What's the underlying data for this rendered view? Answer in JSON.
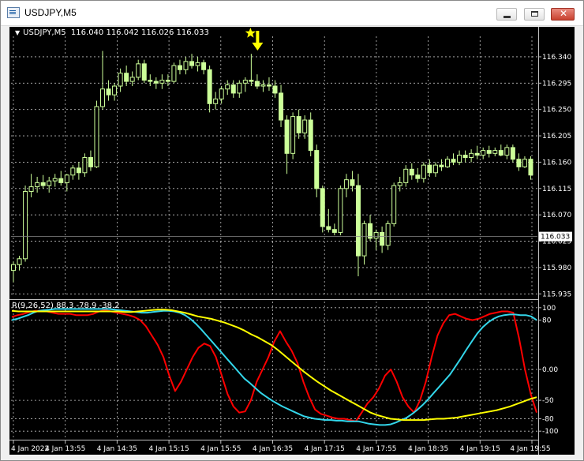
{
  "window": {
    "title": "USDJPY,M5",
    "minimize_icon": "minimize-icon",
    "maximize_icon": "maximize-icon",
    "close_icon": "close-icon"
  },
  "chart_header": {
    "symbol": "USDJPY,M5",
    "ohlc": "116.040 116.042 116.026 116.033"
  },
  "indicator_header": {
    "text": "R(9,26,52) 88.3 -78.9 -38.2"
  },
  "colors": {
    "background": "#000000",
    "candle": "#ccff99",
    "grid": "#c0c0c0",
    "axis_text": "#ffffff",
    "line_red": "#ff0000",
    "line_cyan": "#33d6ea",
    "line_yellow": "#ffff00",
    "marker": "#ffff00",
    "current_price_bg": "#ffffff"
  },
  "chart_data": [
    {
      "type": "candlestick",
      "title": "USDJPY,M5",
      "y_ticks": [
        "116.340",
        "116.295",
        "116.250",
        "116.205",
        "116.160",
        "116.115",
        "116.070",
        "116.025",
        "115.980",
        "115.935"
      ],
      "current_price": "116.033",
      "x_ticks": [
        "4 Jan 2022",
        "4 Jan 13:55",
        "4 Jan 14:35",
        "4 Jan 15:15",
        "4 Jan 15:55",
        "4 Jan 16:35",
        "4 Jan 17:15",
        "4 Jan 17:55",
        "4 Jan 18:35",
        "4 Jan 19:15",
        "4 Jan 19:55"
      ],
      "ylim": [
        115.93,
        116.375
      ],
      "grid": true,
      "annotations": [
        "star-marker",
        "down-arrow-marker"
      ],
      "candles": [
        {
          "o": 115.975,
          "h": 115.99,
          "l": 115.955,
          "c": 115.985
        },
        {
          "o": 115.985,
          "h": 116.0,
          "l": 115.975,
          "c": 115.995
        },
        {
          "o": 115.995,
          "h": 116.12,
          "l": 115.99,
          "c": 116.11
        },
        {
          "o": 116.11,
          "h": 116.14,
          "l": 116.1,
          "c": 116.118
        },
        {
          "o": 116.118,
          "h": 116.135,
          "l": 116.108,
          "c": 116.125
        },
        {
          "o": 116.125,
          "h": 116.138,
          "l": 116.115,
          "c": 116.12
        },
        {
          "o": 116.12,
          "h": 116.135,
          "l": 116.108,
          "c": 116.128
        },
        {
          "o": 116.128,
          "h": 116.14,
          "l": 116.118,
          "c": 116.132
        },
        {
          "o": 116.132,
          "h": 116.145,
          "l": 116.12,
          "c": 116.125
        },
        {
          "o": 116.125,
          "h": 116.14,
          "l": 116.11,
          "c": 116.138
        },
        {
          "o": 116.138,
          "h": 116.155,
          "l": 116.13,
          "c": 116.15
        },
        {
          "o": 116.15,
          "h": 116.16,
          "l": 116.13,
          "c": 116.142
        },
        {
          "o": 116.142,
          "h": 116.175,
          "l": 116.135,
          "c": 116.168
        },
        {
          "o": 116.168,
          "h": 116.18,
          "l": 116.145,
          "c": 116.152
        },
        {
          "o": 116.152,
          "h": 116.265,
          "l": 116.15,
          "c": 116.255
        },
        {
          "o": 116.255,
          "h": 116.35,
          "l": 116.25,
          "c": 116.285
        },
        {
          "o": 116.285,
          "h": 116.3,
          "l": 116.265,
          "c": 116.275
        },
        {
          "o": 116.275,
          "h": 116.295,
          "l": 116.265,
          "c": 116.29
        },
        {
          "o": 116.29,
          "h": 116.32,
          "l": 116.28,
          "c": 116.312
        },
        {
          "o": 116.312,
          "h": 116.325,
          "l": 116.29,
          "c": 116.298
        },
        {
          "o": 116.298,
          "h": 116.315,
          "l": 116.29,
          "c": 116.305
        },
        {
          "o": 116.305,
          "h": 116.335,
          "l": 116.3,
          "c": 116.328
        },
        {
          "o": 116.328,
          "h": 116.335,
          "l": 116.295,
          "c": 116.3
        },
        {
          "o": 116.3,
          "h": 116.31,
          "l": 116.29,
          "c": 116.298
        },
        {
          "o": 116.298,
          "h": 116.305,
          "l": 116.285,
          "c": 116.295
        },
        {
          "o": 116.295,
          "h": 116.31,
          "l": 116.285,
          "c": 116.3
        },
        {
          "o": 116.3,
          "h": 116.31,
          "l": 116.29,
          "c": 116.298
        },
        {
          "o": 116.298,
          "h": 116.33,
          "l": 116.295,
          "c": 116.325
        },
        {
          "o": 116.325,
          "h": 116.335,
          "l": 116.31,
          "c": 116.318
        },
        {
          "o": 116.318,
          "h": 116.34,
          "l": 116.31,
          "c": 116.332
        },
        {
          "o": 116.332,
          "h": 116.345,
          "l": 116.32,
          "c": 116.325
        },
        {
          "o": 116.325,
          "h": 116.34,
          "l": 116.315,
          "c": 116.33
        },
        {
          "o": 116.33,
          "h": 116.335,
          "l": 116.31,
          "c": 116.318
        },
        {
          "o": 116.318,
          "h": 116.325,
          "l": 116.245,
          "c": 116.26
        },
        {
          "o": 116.26,
          "h": 116.28,
          "l": 116.25,
          "c": 116.268
        },
        {
          "o": 116.268,
          "h": 116.29,
          "l": 116.26,
          "c": 116.285
        },
        {
          "o": 116.285,
          "h": 116.3,
          "l": 116.275,
          "c": 116.292
        },
        {
          "o": 116.292,
          "h": 116.3,
          "l": 116.27,
          "c": 116.278
        },
        {
          "o": 116.278,
          "h": 116.3,
          "l": 116.27,
          "c": 116.295
        },
        {
          "o": 116.295,
          "h": 116.305,
          "l": 116.28,
          "c": 116.3
        },
        {
          "o": 116.3,
          "h": 116.345,
          "l": 116.29,
          "c": 116.298
        },
        {
          "o": 116.298,
          "h": 116.31,
          "l": 116.285,
          "c": 116.29
        },
        {
          "o": 116.29,
          "h": 116.3,
          "l": 116.28,
          "c": 116.292
        },
        {
          "o": 116.292,
          "h": 116.305,
          "l": 116.282,
          "c": 116.29
        },
        {
          "o": 116.29,
          "h": 116.3,
          "l": 116.27,
          "c": 116.278
        },
        {
          "o": 116.278,
          "h": 116.292,
          "l": 116.22,
          "c": 116.232
        },
        {
          "o": 116.232,
          "h": 116.24,
          "l": 116.14,
          "c": 116.175
        },
        {
          "o": 116.175,
          "h": 116.245,
          "l": 116.165,
          "c": 116.238
        },
        {
          "o": 116.238,
          "h": 116.25,
          "l": 116.2,
          "c": 116.21
        },
        {
          "o": 116.21,
          "h": 116.24,
          "l": 116.2,
          "c": 116.232
        },
        {
          "o": 116.232,
          "h": 116.245,
          "l": 116.17,
          "c": 116.18
        },
        {
          "o": 116.18,
          "h": 116.19,
          "l": 116.1,
          "c": 116.115
        },
        {
          "o": 116.115,
          "h": 116.12,
          "l": 116.04,
          "c": 116.05
        },
        {
          "o": 116.05,
          "h": 116.08,
          "l": 116.04,
          "c": 116.045
        },
        {
          "o": 116.045,
          "h": 116.055,
          "l": 116.035,
          "c": 116.04
        },
        {
          "o": 116.04,
          "h": 116.12,
          "l": 116.035,
          "c": 116.115
        },
        {
          "o": 116.115,
          "h": 116.14,
          "l": 116.1,
          "c": 116.13
        },
        {
          "o": 116.13,
          "h": 116.145,
          "l": 116.11,
          "c": 116.12
        },
        {
          "o": 116.12,
          "h": 116.14,
          "l": 115.965,
          "c": 116.0
        },
        {
          "o": 116.0,
          "h": 116.06,
          "l": 115.985,
          "c": 116.055
        },
        {
          "o": 116.055,
          "h": 116.07,
          "l": 116.025,
          "c": 116.03
        },
        {
          "o": 116.03,
          "h": 116.045,
          "l": 116.01,
          "c": 116.04
        },
        {
          "o": 116.04,
          "h": 116.05,
          "l": 116.005,
          "c": 116.018
        },
        {
          "o": 116.018,
          "h": 116.06,
          "l": 116.01,
          "c": 116.055
        },
        {
          "o": 116.055,
          "h": 116.125,
          "l": 116.05,
          "c": 116.12
        },
        {
          "o": 116.12,
          "h": 116.135,
          "l": 116.11,
          "c": 116.125
        },
        {
          "o": 116.125,
          "h": 116.155,
          "l": 116.118,
          "c": 116.148
        },
        {
          "o": 116.148,
          "h": 116.158,
          "l": 116.13,
          "c": 116.138
        },
        {
          "o": 116.138,
          "h": 116.15,
          "l": 116.125,
          "c": 116.132
        },
        {
          "o": 116.132,
          "h": 116.16,
          "l": 116.125,
          "c": 116.155
        },
        {
          "o": 116.155,
          "h": 116.165,
          "l": 116.135,
          "c": 116.142
        },
        {
          "o": 116.142,
          "h": 116.16,
          "l": 116.135,
          "c": 116.155
        },
        {
          "o": 116.155,
          "h": 116.165,
          "l": 116.145,
          "c": 116.152
        },
        {
          "o": 116.152,
          "h": 116.17,
          "l": 116.15,
          "c": 116.165
        },
        {
          "o": 116.165,
          "h": 116.175,
          "l": 116.155,
          "c": 116.16
        },
        {
          "o": 116.16,
          "h": 116.18,
          "l": 116.155,
          "c": 116.172
        },
        {
          "o": 116.172,
          "h": 116.18,
          "l": 116.16,
          "c": 116.168
        },
        {
          "o": 116.168,
          "h": 116.182,
          "l": 116.16,
          "c": 116.175
        },
        {
          "o": 116.175,
          "h": 116.188,
          "l": 116.165,
          "c": 116.172
        },
        {
          "o": 116.172,
          "h": 116.185,
          "l": 116.165,
          "c": 116.18
        },
        {
          "o": 116.18,
          "h": 116.188,
          "l": 116.168,
          "c": 116.175
        },
        {
          "o": 116.175,
          "h": 116.185,
          "l": 116.17,
          "c": 116.18
        },
        {
          "o": 116.18,
          "h": 116.19,
          "l": 116.17,
          "c": 116.172
        },
        {
          "o": 116.172,
          "h": 116.19,
          "l": 116.165,
          "c": 116.185
        },
        {
          "o": 116.185,
          "h": 116.19,
          "l": 116.16,
          "c": 116.165
        },
        {
          "o": 116.165,
          "h": 116.175,
          "l": 116.145,
          "c": 116.152
        },
        {
          "o": 116.152,
          "h": 116.17,
          "l": 116.15,
          "c": 116.165
        },
        {
          "o": 116.165,
          "h": 116.17,
          "l": 116.13,
          "c": 116.138
        }
      ]
    },
    {
      "type": "line",
      "title": "R(9,26,52) 88.3 -78.9 -38.2",
      "y_ticks": [
        "100",
        "80",
        "0.00",
        "-50",
        "-80",
        "-100"
      ],
      "ylim": [
        -110,
        110
      ],
      "grid": true,
      "series": [
        {
          "color": "#ff0000",
          "values": [
            85,
            88,
            90,
            93,
            95,
            95,
            94,
            92,
            90,
            90,
            90,
            88,
            88,
            88,
            90,
            94,
            96,
            94,
            92,
            90,
            88,
            85,
            80,
            70,
            55,
            40,
            20,
            -10,
            -35,
            -20,
            0,
            20,
            35,
            42,
            38,
            20,
            -10,
            -40,
            -60,
            -70,
            -68,
            -50,
            -20,
            0,
            20,
            45,
            62,
            45,
            30,
            10,
            -20,
            -45,
            -65,
            -72,
            -75,
            -78,
            -80,
            -80,
            -82,
            -84,
            -70,
            -55,
            -45,
            -30,
            -10,
            0,
            -20,
            -45,
            -60,
            -70,
            -50,
            -20,
            20,
            55,
            75,
            88,
            90,
            86,
            82,
            80,
            82,
            86,
            90,
            92,
            94,
            94,
            92,
            50,
            0,
            -40,
            -70
          ]
        },
        {
          "color": "#33d6ea",
          "values": [
            80,
            82,
            85,
            88,
            92,
            95,
            96,
            97,
            98,
            98,
            98,
            98,
            98,
            98,
            98,
            98,
            98,
            98,
            98,
            97,
            96,
            95,
            94,
            93,
            92,
            92,
            93,
            94,
            95,
            95,
            94,
            92,
            88,
            82,
            74,
            65,
            55,
            45,
            35,
            25,
            15,
            5,
            -5,
            -15,
            -22,
            -30,
            -38,
            -44,
            -50,
            -55,
            -60,
            -64,
            -68,
            -72,
            -76,
            -78,
            -80,
            -81,
            -82,
            -82,
            -83,
            -83,
            -84,
            -84,
            -84,
            -86,
            -88,
            -89,
            -90,
            -90,
            -89,
            -86,
            -82,
            -78,
            -72,
            -65,
            -57,
            -48,
            -38,
            -28,
            -18,
            -8,
            5,
            18,
            32,
            45,
            58,
            68,
            76,
            82,
            86,
            88,
            89,
            89,
            88,
            88,
            86,
            80
          ]
        },
        {
          "color": "#ffff00",
          "values": [
            95,
            94,
            94,
            94,
            94,
            94,
            94,
            94,
            94,
            94,
            94,
            94,
            94,
            94,
            94,
            94,
            94,
            93,
            93,
            94,
            95,
            96,
            97,
            97,
            96,
            94,
            92,
            89,
            86,
            84,
            82,
            79,
            76,
            72,
            68,
            63,
            57,
            52,
            46,
            40,
            32,
            23,
            14,
            5,
            -4,
            -12,
            -20,
            -27,
            -34,
            -40,
            -46,
            -52,
            -58,
            -64,
            -70,
            -74,
            -77,
            -80,
            -81,
            -82,
            -82,
            -82,
            -82,
            -81,
            -80,
            -80,
            -79,
            -78,
            -76,
            -74,
            -72,
            -70,
            -68,
            -66,
            -63,
            -60,
            -56,
            -52,
            -48,
            -45
          ]
        }
      ]
    }
  ]
}
